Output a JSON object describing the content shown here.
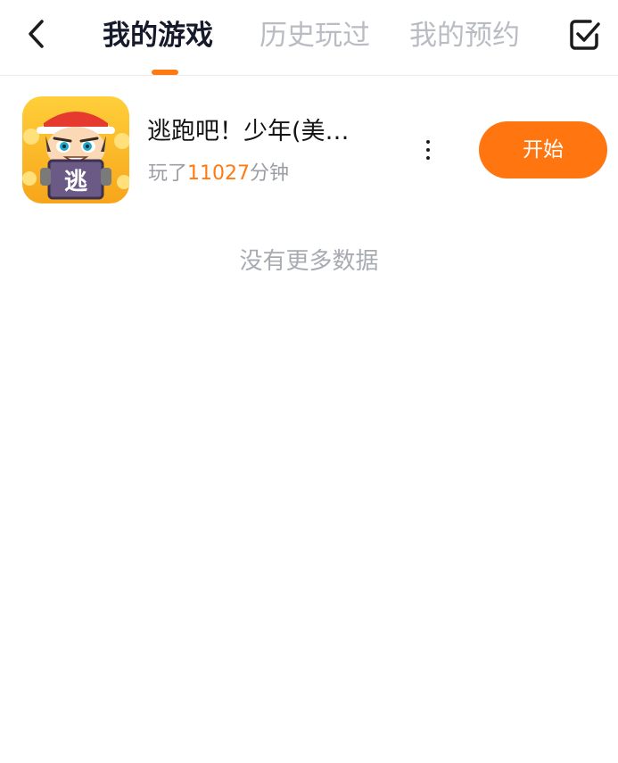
{
  "header": {
    "back_icon": "chevron-left-icon",
    "tabs": [
      {
        "label": "我的游戏",
        "active": true
      },
      {
        "label": "历史玩过",
        "active": false
      },
      {
        "label": "我的预约",
        "active": false
      }
    ],
    "manage_icon": "checkbox-check-icon"
  },
  "games": [
    {
      "title": "逃跑吧！少年(美…",
      "icon_char": "逃",
      "playtime_prefix": "玩了",
      "playtime_minutes": "11027",
      "playtime_suffix": "分钟",
      "more_icon": "more-vertical-icon",
      "action_label": "开始"
    }
  ],
  "list_footer": "没有更多数据",
  "colors": {
    "accent": "#ff7611",
    "active_tab": "#161a2b",
    "inactive_tab": "#b9bcc2",
    "muted_text": "#9b9ea4"
  }
}
